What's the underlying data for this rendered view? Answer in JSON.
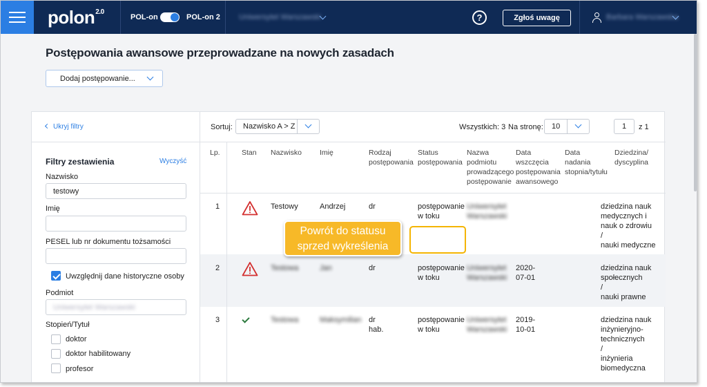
{
  "topbar": {
    "logo": "polon",
    "logo_sup": "2.0",
    "toggle_left": "POL-on",
    "toggle_right": "POL-on 2",
    "institution": "Uniwersytet Warszawski",
    "report_button": "Zgłoś uwagę",
    "user_name": "Barbara Warszawska",
    "help_glyph": "?"
  },
  "page": {
    "title": "Postępowania awansowe przeprowadzane na nowych zasadach",
    "add_dropdown": "Dodaj postępowanie..."
  },
  "filters": {
    "hide_label": "Ukryj filtry",
    "title": "Filtry zestawienia",
    "clear_label": "Wyczyść",
    "surname_label": "Nazwisko",
    "surname_value": "testowy",
    "firstname_label": "Imię",
    "firstname_value": "",
    "pesel_label": "PESEL lub nr dokumentu tożsamości",
    "pesel_value": "",
    "historic_label": "Uwzględnij dane historyczne osoby",
    "historic_checked": true,
    "entity_label": "Podmiot",
    "entity_value": "Uniwersytet Warszawski",
    "degree_label": "Stopień/Tytuł",
    "degree_options": [
      "doktor",
      "doktor habilitowany",
      "profesor"
    ]
  },
  "toolbar": {
    "sort_label": "Sortuj:",
    "sort_value": "Nazwisko A > Z",
    "total": "Wszystkich: 3",
    "per_page_label": "Na stronę:",
    "per_page_value": "10",
    "page_current": "1",
    "page_of": "z 1"
  },
  "table": {
    "headers": {
      "lp": "Lp.",
      "stan": "Stan",
      "nazwisko": "Nazwisko",
      "imie": "Imię",
      "rodzaj": [
        "Rodzaj",
        "postępowania"
      ],
      "status": [
        "Status",
        "postępowania"
      ],
      "podmiot": [
        "Nazwa",
        "podmiotu",
        "prowadzącego",
        "postępowanie"
      ],
      "data_wszczecia": [
        "Data",
        "wszczęcia",
        "postępowania",
        "awansowego"
      ],
      "data_nadania": [
        "Data",
        "nadania",
        "stopnia/tytułu"
      ],
      "dziedzina": [
        "Dziedzina/",
        "dyscyplina"
      ]
    },
    "rows": [
      {
        "lp": "1",
        "stan": "warning-icon",
        "nazwisko": "Testowy",
        "imie": "Andrzej",
        "rodzaj": [
          "dr"
        ],
        "status": [
          "postępowanie",
          "w toku"
        ],
        "podmiot": [
          "Uniwersytet",
          "Warszawski"
        ],
        "data_wszczecia": [
          "",
          ""
        ],
        "data_nadania": "",
        "dziedzina": [
          "dziedzina nauk",
          "medycznych i",
          "nauk o zdrowiu",
          "/",
          "nauki medyczne"
        ]
      },
      {
        "lp": "2",
        "stan": "warning-icon",
        "nazwisko": "Testowa",
        "imie": "Jan",
        "rodzaj": [
          "dr"
        ],
        "status": [
          "postępowanie",
          "w toku"
        ],
        "podmiot": [
          "Uniwersytet",
          "Warszawski"
        ],
        "data_wszczecia": [
          "2020-",
          "07-01"
        ],
        "data_nadania": "",
        "dziedzina": [
          "dziedzina nauk",
          "społecznych",
          "/",
          "nauki prawne"
        ]
      },
      {
        "lp": "3",
        "stan": "check-icon",
        "nazwisko": "Testowa",
        "imie": "Maksymilian",
        "rodzaj": [
          "dr",
          "hab."
        ],
        "status": [
          "postępowanie",
          "w toku"
        ],
        "podmiot": [
          "Uniwersytet",
          "Warszawski"
        ],
        "data_wszczecia": [
          "2019-",
          "10-01"
        ],
        "data_nadania": "",
        "dziedzina": [
          "dziedzina nauk",
          "inżynieryjno-",
          "technicznych",
          "/",
          "inżynieria",
          "biomedyczna"
        ]
      }
    ]
  },
  "callout": {
    "line1": "Powrót do statusu",
    "line2": "sprzed wykreślenia"
  },
  "colors": {
    "topbar": "#0f2a55",
    "accent": "#2b7ee3",
    "callout": "#f7b928",
    "warning": "#d32f2f",
    "ok": "#2c7a3e"
  }
}
